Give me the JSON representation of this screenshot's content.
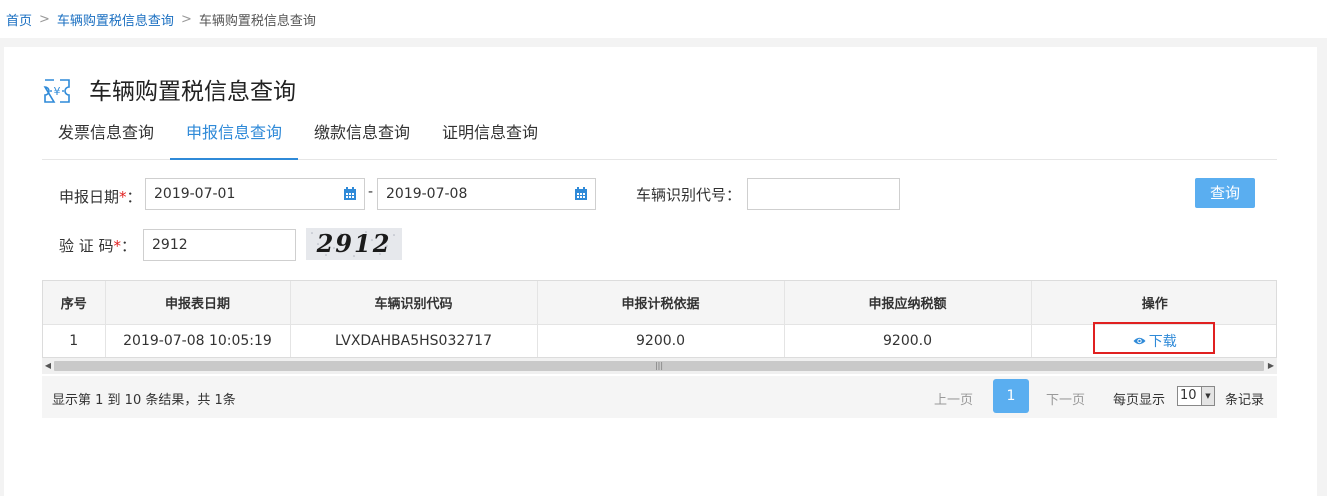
{
  "breadcrumb": {
    "home": "首页",
    "parent": "车辆购置税信息查询",
    "current": "车辆购置税信息查询",
    "separator": ">"
  },
  "page": {
    "title": "车辆购置税信息查询",
    "title_icon": "yuan-ticket-icon"
  },
  "tabs": [
    {
      "label": "发票信息查询",
      "active": false
    },
    {
      "label": "申报信息查询",
      "active": true
    },
    {
      "label": "缴款信息查询",
      "active": false
    },
    {
      "label": "证明信息查询",
      "active": false
    }
  ],
  "form": {
    "date_label": "申报日期",
    "required_mark": "*",
    "colon": "：",
    "start_date": "2019-07-01",
    "end_date": "2019-07-08",
    "date_separator": "-",
    "vin_label": "车辆识别代号：",
    "vin_value": "",
    "captcha_label": "验 证 码",
    "captcha_value": "2912",
    "captcha_image_text": "2912",
    "query_button": "查询"
  },
  "table": {
    "columns": [
      "序号",
      "申报表日期",
      "车辆识别代码",
      "申报计税依据",
      "申报应纳税额",
      "操作"
    ],
    "rows": [
      {
        "index": "1",
        "date": "2019-07-08 10:05:19",
        "vin": "LVXDAHBA5HS032717",
        "tax_basis": "9200.0",
        "tax_amount": "9200.0",
        "action": "下载"
      }
    ]
  },
  "pagination": {
    "summary": "显示第 1 到 10 条结果，共 1条",
    "prev": "上一页",
    "current_page": "1",
    "next": "下一页",
    "page_size_label": "每页显示",
    "page_size": "10",
    "page_size_suffix": "条记录"
  },
  "colors": {
    "accent": "#2f8ad8",
    "button": "#5aaef0",
    "required": "#e02020",
    "highlight_box": "#e02020"
  }
}
